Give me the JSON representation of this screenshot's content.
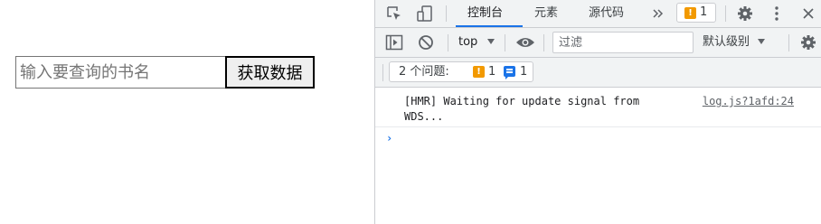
{
  "page": {
    "search_placeholder": "输入要查询的书名",
    "button_label": "获取数据"
  },
  "devtools": {
    "tabs": [
      "控制台",
      "元素",
      "源代码"
    ],
    "active_tab": "控制台",
    "more_tabs_icon": "chevron-double-right",
    "issue_count": "1",
    "toolbar": {
      "context": "top",
      "filter_placeholder": "过滤",
      "level": "默认级别"
    },
    "issues": {
      "label": "2 个问题:",
      "warning_count": "1",
      "info_count": "1"
    },
    "messages": [
      {
        "text": "[HMR] Waiting for update signal from WDS...",
        "source": "log.js?1afd:24"
      }
    ],
    "colors": {
      "accent": "#1a73e8",
      "warning": "#f29900",
      "panel_bg": "#f1f3f4",
      "border": "#cbcdd1"
    },
    "icons": [
      "inspect-icon",
      "device-toggle-icon",
      "settings-icon",
      "kebab-menu-icon",
      "close-icon",
      "sidebar-toggle-icon",
      "clear-console-icon",
      "eye-icon"
    ]
  }
}
